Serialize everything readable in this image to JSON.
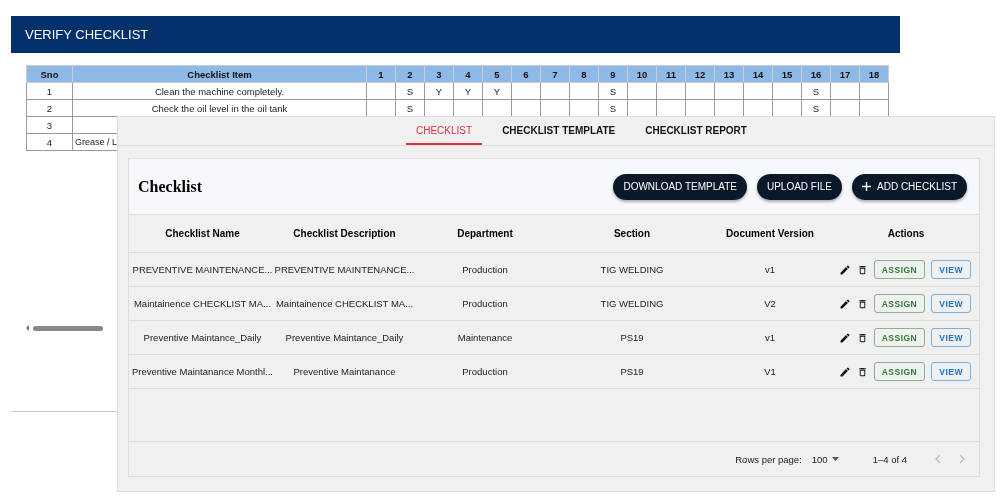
{
  "background_page": {
    "title": "VERIFY CHECKLIST",
    "table": {
      "columns": [
        "Sno",
        "Checklist Item",
        "1",
        "2",
        "3",
        "4",
        "5",
        "6",
        "7",
        "8",
        "9",
        "10",
        "11",
        "12",
        "13",
        "14",
        "15",
        "16",
        "17",
        "18"
      ],
      "rows": [
        {
          "sno": "1",
          "item": "Clean the machine completely.",
          "kind": "full",
          "cells": [
            null,
            "S",
            "Y",
            "Y",
            "Y",
            null,
            null,
            null,
            "S",
            null,
            null,
            null,
            null,
            null,
            null,
            "S",
            null,
            null
          ]
        },
        {
          "sno": "2",
          "item": "Check the oil level in the oil tank",
          "kind": "full",
          "cells": [
            null,
            "S",
            null,
            null,
            null,
            null,
            null,
            null,
            "S",
            null,
            null,
            null,
            null,
            null,
            null,
            "S",
            null,
            null
          ]
        },
        {
          "sno": "3"
        },
        {
          "sno": "4",
          "item": "Grease / L",
          "kind": "partial"
        }
      ]
    }
  },
  "panel": {
    "tabs": [
      {
        "label": "CHECKLIST",
        "selected": true
      },
      {
        "label": "CHECKLIST TEMPLATE",
        "selected": false
      },
      {
        "label": "CHECKLIST REPORT",
        "selected": false
      }
    ],
    "card": {
      "title": "Checklist",
      "buttons": [
        {
          "label": "DOWNLOAD TEMPLATE",
          "kind": "plain"
        },
        {
          "label": "UPLOAD FILE",
          "kind": "plain"
        },
        {
          "label": "ADD CHECKLIST",
          "kind": "add"
        }
      ]
    },
    "table": {
      "columns": [
        "Checklist Name",
        "Checklist Description",
        "Department",
        "Section",
        "Document Version",
        "Actions"
      ],
      "rows": [
        {
          "name": "PREVENTIVE MAINTENANCE...",
          "description": "PREVENTIVE MAINTENANCE...",
          "department": "Production",
          "section": "TIG WELDING",
          "version": "v1",
          "assign": "ASSIGN",
          "view": "VIEW"
        },
        {
          "name": "Maintainence CHECKLIST MA...",
          "description": "Maintainence CHECKLIST MA...",
          "department": "Production",
          "section": "TIG WELDING",
          "version": "V2",
          "assign": "ASSIGN",
          "view": "VIEW"
        },
        {
          "name": "Preventive Maintance_Daily",
          "description": "Preventive Maintance_Daily",
          "department": "Maintenance",
          "section": "PS19",
          "version": "v1",
          "assign": "ASSIGN",
          "view": "VIEW"
        },
        {
          "name": "Preventive Maintanance Monthl...",
          "description": "Preventive Maintanance",
          "department": "Production",
          "section": "PS19",
          "version": "V1",
          "assign": "ASSIGN",
          "view": "VIEW"
        }
      ]
    },
    "pagination": {
      "rows_per_page_label": "Rows per page:",
      "rows_per_page": "100",
      "range": "1–4 of 4"
    }
  }
}
